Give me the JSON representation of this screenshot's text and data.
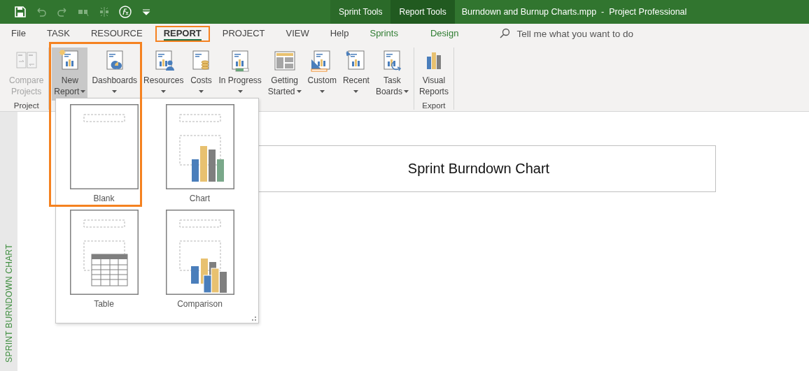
{
  "quick_access": {
    "items": [
      {
        "kind": "save",
        "disabled": false
      },
      {
        "kind": "undo",
        "disabled": true
      },
      {
        "kind": "redo",
        "disabled": true
      },
      {
        "kind": "link",
        "disabled": true
      },
      {
        "kind": "split",
        "disabled": true
      },
      {
        "kind": "formula",
        "disabled": false
      },
      {
        "kind": "customize",
        "disabled": false
      }
    ]
  },
  "contextual_headers": [
    {
      "label": "Sprint Tools",
      "active": false
    },
    {
      "label": "Report Tools",
      "active": true
    }
  ],
  "window": {
    "title": "Burndown and Burnup Charts.mpp  -  Project Professional"
  },
  "tabs": [
    {
      "label": "File",
      "selected": false,
      "contextual": false,
      "highlighted": false
    },
    {
      "label": "TASK",
      "selected": false,
      "contextual": false,
      "highlighted": false
    },
    {
      "label": "RESOURCE",
      "selected": false,
      "contextual": false,
      "highlighted": false
    },
    {
      "label": "REPORT",
      "selected": true,
      "contextual": false,
      "highlighted": true
    },
    {
      "label": "PROJECT",
      "selected": false,
      "contextual": false,
      "highlighted": false
    },
    {
      "label": "VIEW",
      "selected": false,
      "contextual": false,
      "highlighted": false
    },
    {
      "label": "Help",
      "selected": false,
      "contextual": false,
      "highlighted": false
    },
    {
      "label": "Sprints",
      "selected": false,
      "contextual": true,
      "highlighted": false
    },
    {
      "label": "Design",
      "selected": false,
      "contextual": true,
      "highlighted": false
    }
  ],
  "search": {
    "placeholder": "Tell me what you want to do"
  },
  "ribbon": {
    "groups": [
      {
        "label": "Project",
        "buttons": [
          {
            "kind": "compare",
            "lines": [
              "Compare",
              "Projects"
            ],
            "dropdown": false,
            "disabled": true,
            "pressed": false
          }
        ]
      },
      {
        "buttons": [
          {
            "kind": "new",
            "lines": [
              "New",
              "Report"
            ],
            "dropdown": true,
            "disabled": false,
            "pressed": true
          },
          {
            "kind": "dashboards",
            "lines": [
              "Dashboards"
            ],
            "dropdown": true,
            "disabled": false,
            "pressed": false
          },
          {
            "kind": "resources",
            "lines": [
              "Resources"
            ],
            "dropdown": true,
            "disabled": false,
            "pressed": false
          },
          {
            "kind": "costs",
            "lines": [
              "Costs"
            ],
            "dropdown": true,
            "disabled": false,
            "pressed": false
          },
          {
            "kind": "progress",
            "lines": [
              "In Progress"
            ],
            "dropdown": true,
            "disabled": false,
            "pressed": false
          },
          {
            "kind": "getting-started",
            "lines": [
              "Getting",
              "Started"
            ],
            "dropdown": true,
            "disabled": false,
            "pressed": false
          },
          {
            "kind": "custom",
            "lines": [
              "Custom"
            ],
            "dropdown": true,
            "disabled": false,
            "pressed": false
          },
          {
            "kind": "recent",
            "lines": [
              "Recent"
            ],
            "dropdown": true,
            "disabled": false,
            "pressed": false
          },
          {
            "kind": "task-boards",
            "lines": [
              "Task",
              "Boards"
            ],
            "dropdown": true,
            "disabled": false,
            "pressed": false
          }
        ]
      },
      {
        "label": "Export",
        "buttons": [
          {
            "kind": "visual",
            "lines": [
              "Visual",
              "Reports"
            ],
            "dropdown": false,
            "disabled": false,
            "pressed": false
          }
        ]
      }
    ]
  },
  "highlight_frame": true,
  "side_label": "SPRINT BURNDOWN CHART",
  "report": {
    "title": "Sprint Burndown Chart"
  },
  "new_report_menu": {
    "items": [
      {
        "label": "Blank",
        "kind": "blank"
      },
      {
        "label": "Chart",
        "kind": "chart"
      },
      {
        "label": "Table",
        "kind": "table"
      },
      {
        "label": "Comparison",
        "kind": "comparison"
      }
    ]
  }
}
